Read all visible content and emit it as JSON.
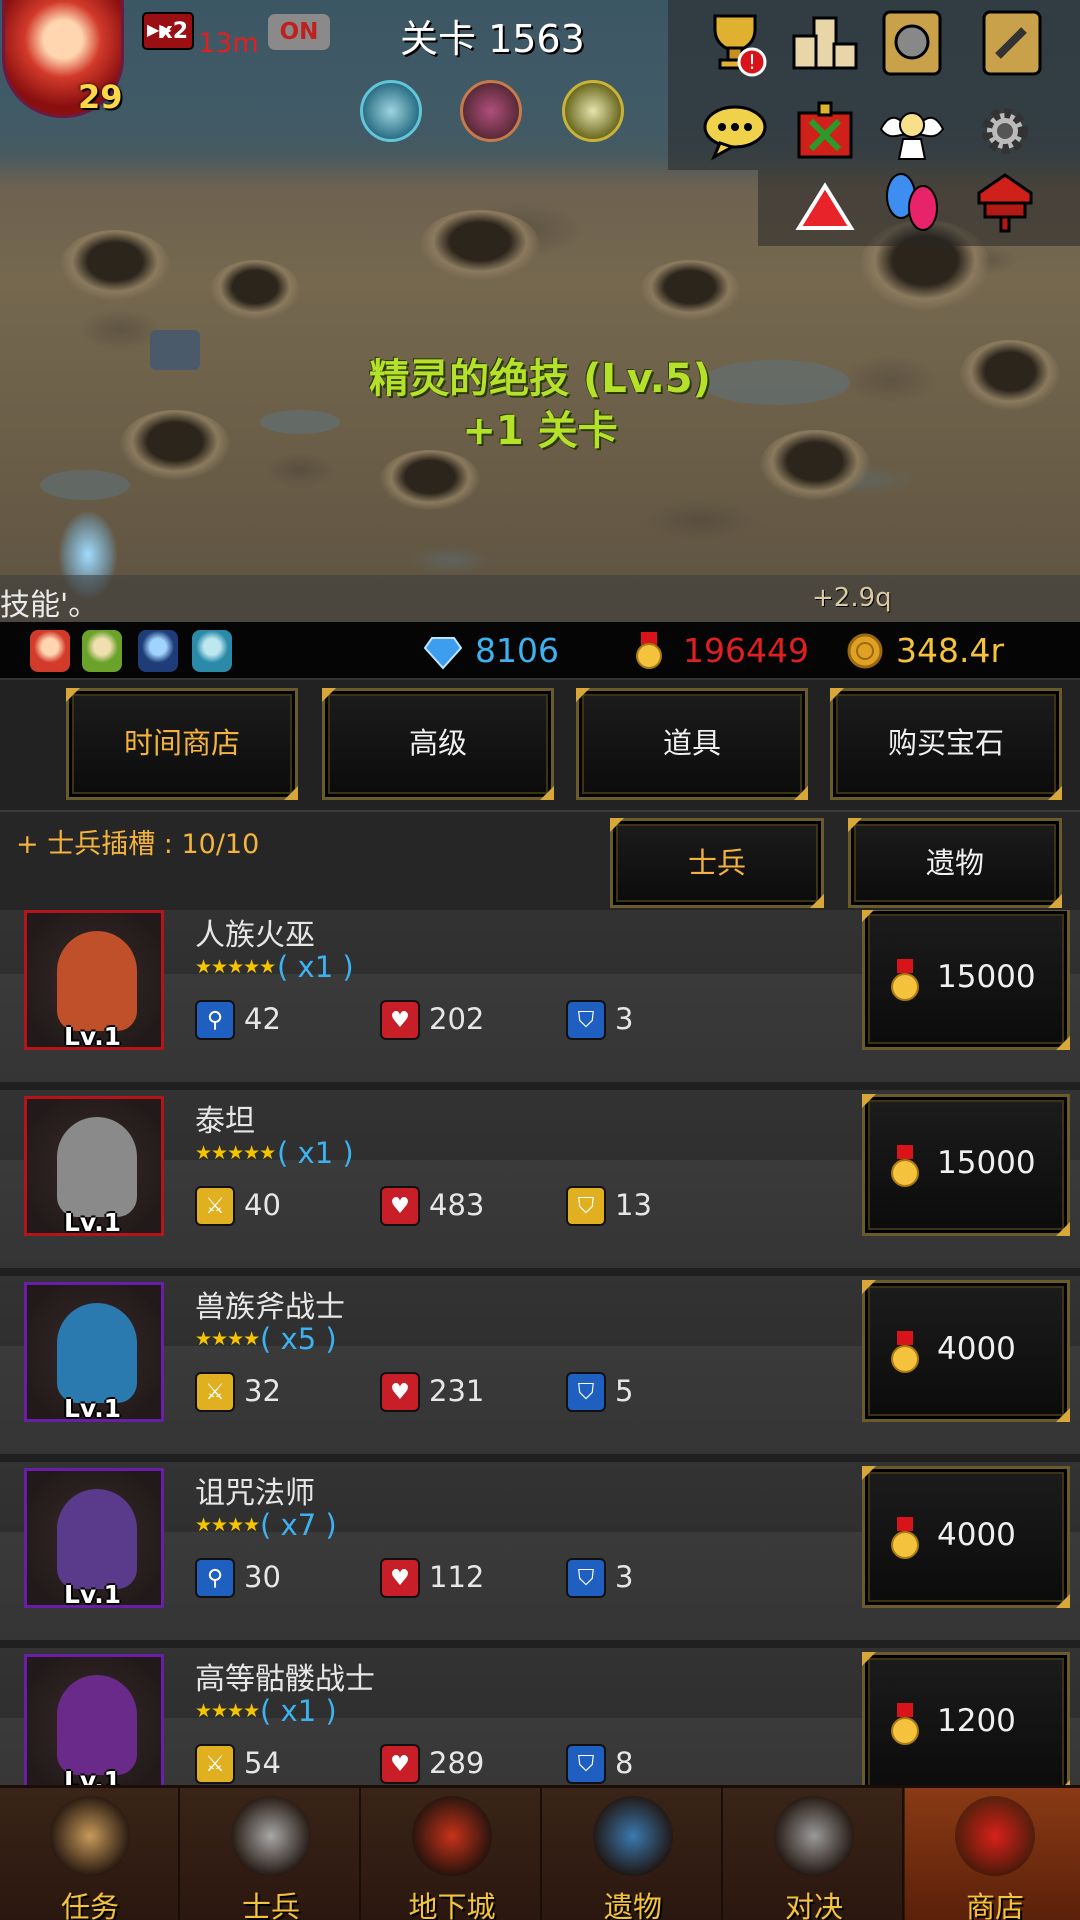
{
  "hud": {
    "player_level": "29",
    "speed_label": "x2",
    "speed_timer": "13m",
    "speed_toggle": "ON",
    "stage_title": "关卡 1563",
    "top_icons": [
      "trophy-icon",
      "leaderboard-icon",
      "knight-card-icon",
      "scroll-card-icon",
      "chat-icon",
      "treasure-chest-icon",
      "angel-icon",
      "gear-icon",
      "red-triangle-icon",
      "friends-icon",
      "mailbox-icon"
    ],
    "buff_icons": [
      "tower-buff-icon",
      "orb-buff-icon",
      "arrow-buff-icon"
    ]
  },
  "battle": {
    "skill_name": "精灵的绝技 (Lv.5)",
    "skill_bonus": "+1 关卡",
    "log_text": "技能'。",
    "floating_damage": "+2.9q"
  },
  "resources": {
    "gems": "8106",
    "medals": "196449",
    "gold": "348.4r",
    "colors": {
      "gems": "#3db2f0",
      "medals": "#e02020",
      "gold": "#f4c23c"
    }
  },
  "shop_tabs": [
    {
      "label": "时间商店",
      "active": true
    },
    {
      "label": "高级",
      "active": false
    },
    {
      "label": "道具",
      "active": false
    },
    {
      "label": "购买宝石",
      "active": false
    }
  ],
  "sub": {
    "slots": "+ 士兵插槽 : 10/10",
    "tabs": [
      {
        "label": "士兵",
        "active": true
      },
      {
        "label": "遗物",
        "active": false
      }
    ]
  },
  "units": [
    {
      "name": "人族火巫",
      "stars": "★★★★★",
      "count": "( x1 )",
      "level": "Lv.1",
      "frame": "#b5141a",
      "stat1_icon": "magic-staff-icon",
      "stat1": "42",
      "hp": "202",
      "def_icon": "blue-shield-icon",
      "def": "3",
      "price": "15000"
    },
    {
      "name": "泰坦",
      "stars": "★★★★★",
      "count": "( x1 )",
      "level": "Lv.1",
      "frame": "#b5141a",
      "stat1_icon": "sword-icon",
      "stat1": "40",
      "hp": "483",
      "def_icon": "gold-shield-icon",
      "def": "13",
      "price": "15000"
    },
    {
      "name": "兽族斧战士",
      "stars": "★★★★",
      "count": "( x5 )",
      "level": "Lv.1",
      "frame": "#6a1ea8",
      "stat1_icon": "sword-icon",
      "stat1": "32",
      "hp": "231",
      "def_icon": "blue-shield-icon",
      "def": "5",
      "price": "4000"
    },
    {
      "name": "诅咒法师",
      "stars": "★★★★",
      "count": "( x7 )",
      "level": "Lv.1",
      "frame": "#6a1ea8",
      "stat1_icon": "magic-staff-icon",
      "stat1": "30",
      "hp": "112",
      "def_icon": "blue-shield-icon",
      "def": "3",
      "price": "4000"
    },
    {
      "name": "高等骷髅战士",
      "stars": "★★★★",
      "count": "( x1 )",
      "level": "Lv.1",
      "frame": "#6a1ea8",
      "stat1_icon": "sword-icon",
      "stat1": "54",
      "hp": "289",
      "def_icon": "blue-shield-icon",
      "def": "8",
      "price": "1200"
    }
  ],
  "nav": [
    {
      "label": "任务",
      "icon": "quest-scroll-icon",
      "active": false
    },
    {
      "label": "士兵",
      "icon": "soldier-helmet-icon",
      "active": false
    },
    {
      "label": "地下城",
      "icon": "dungeon-monster-icon",
      "active": false
    },
    {
      "label": "遗物",
      "icon": "relic-orb-icon",
      "active": false
    },
    {
      "label": "对决",
      "icon": "crossed-swords-icon",
      "active": false
    },
    {
      "label": "商店",
      "icon": "shop-stall-icon",
      "active": true
    }
  ]
}
